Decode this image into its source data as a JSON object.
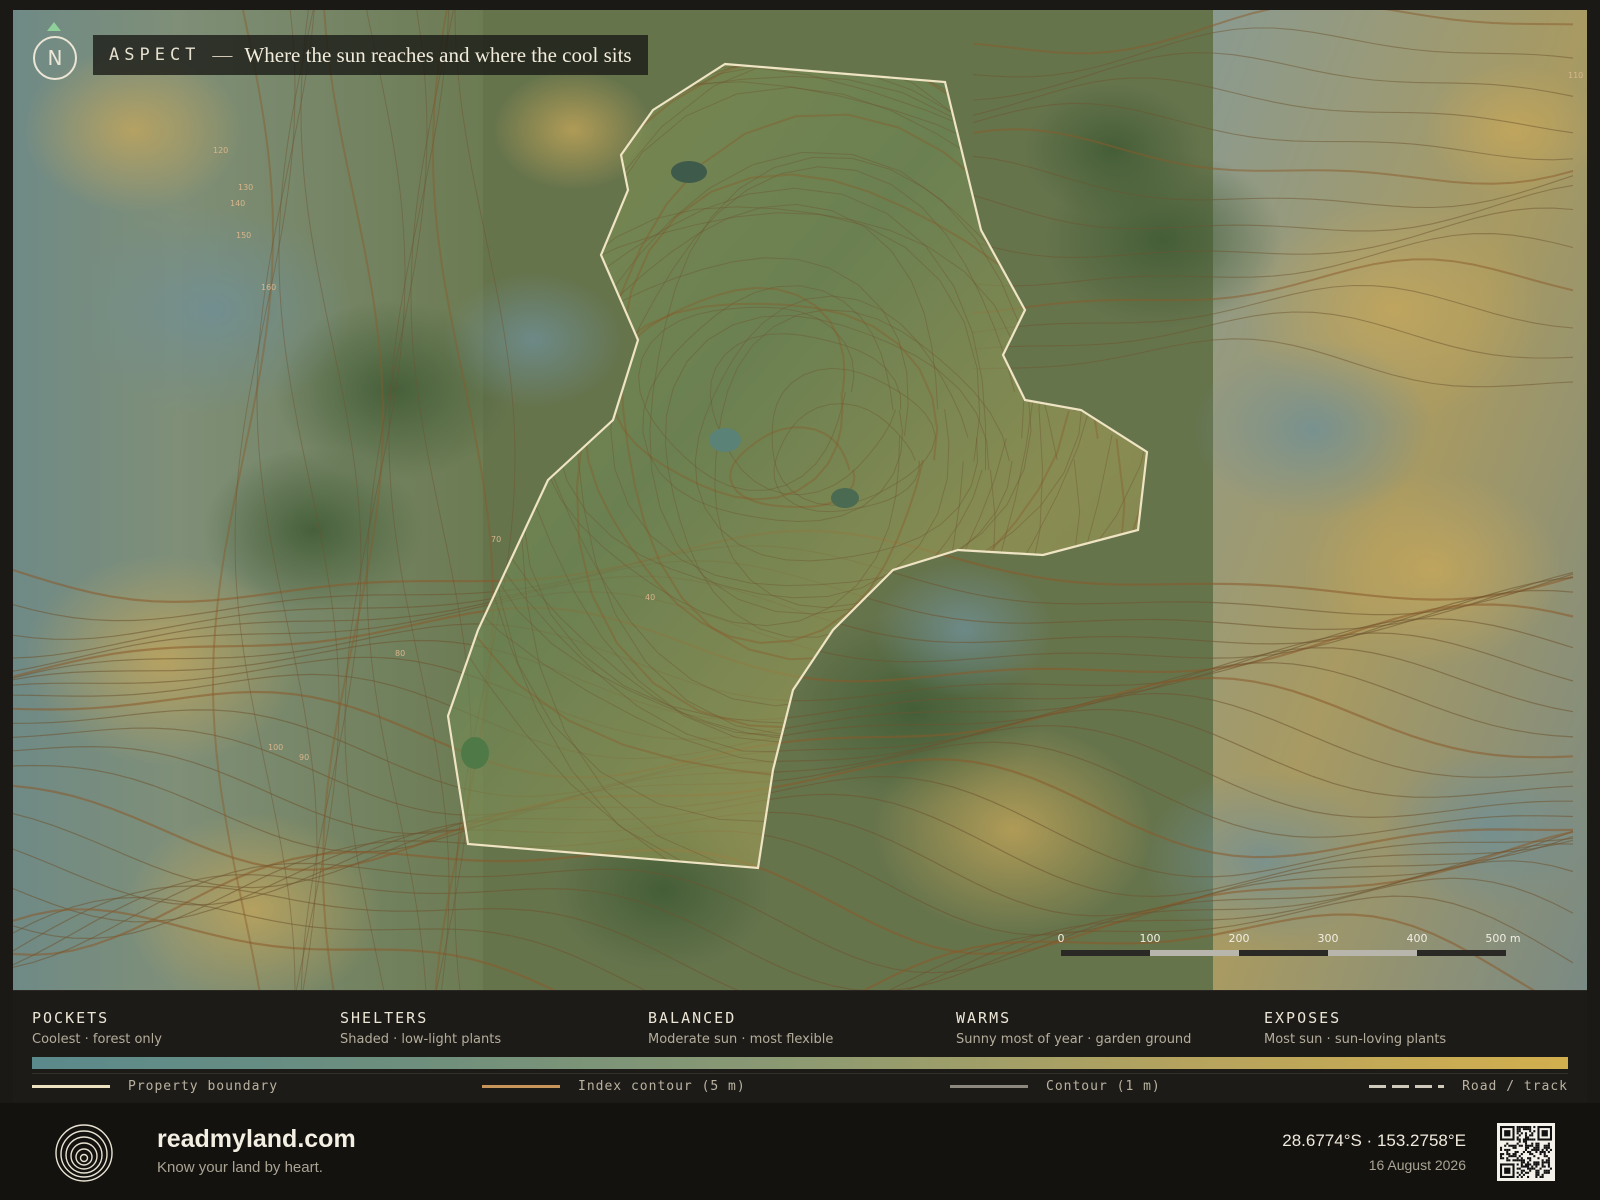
{
  "map": {
    "north_label": "N",
    "title_kicker": "ASPECT",
    "title_separator": "—",
    "title_text": "Where the sun reaches and where the cool sits",
    "contour_labels": [
      "120",
      "130",
      "140",
      "150",
      "160",
      "70",
      "80",
      "100",
      "90",
      "110",
      "40"
    ],
    "scale_labels": [
      "0",
      "100",
      "200",
      "300",
      "400",
      "500 m"
    ],
    "colors": {
      "boundary": "#efe4c4",
      "index_contour": "#8a5a2a",
      "contour": "#6e5330",
      "cool": "#5b8a8c",
      "warm": "#d2af4e"
    }
  },
  "legend": {
    "classes": [
      {
        "name": "POCKETS",
        "desc": "Coolest · forest only"
      },
      {
        "name": "SHELTERS",
        "desc": "Shaded · low-light plants"
      },
      {
        "name": "BALANCED",
        "desc": "Moderate sun · most flexible"
      },
      {
        "name": "WARMS",
        "desc": "Sunny most of year · garden ground"
      },
      {
        "name": "EXPOSES",
        "desc": "Most sun · sun-loving plants"
      }
    ],
    "keys": {
      "boundary": "Property boundary",
      "index_contour": "Index contour (5 m)",
      "contour": "Contour (1 m)",
      "road": "Road / track"
    },
    "key_colors": {
      "boundary": "#ece2c2",
      "index_contour": "#c7955a",
      "contour": "#8c887d"
    }
  },
  "footer": {
    "brand": "readmyland.com",
    "tagline": "Know your land by heart.",
    "coords": "28.6774°S · 153.2758°E",
    "date": "16 August 2026"
  }
}
